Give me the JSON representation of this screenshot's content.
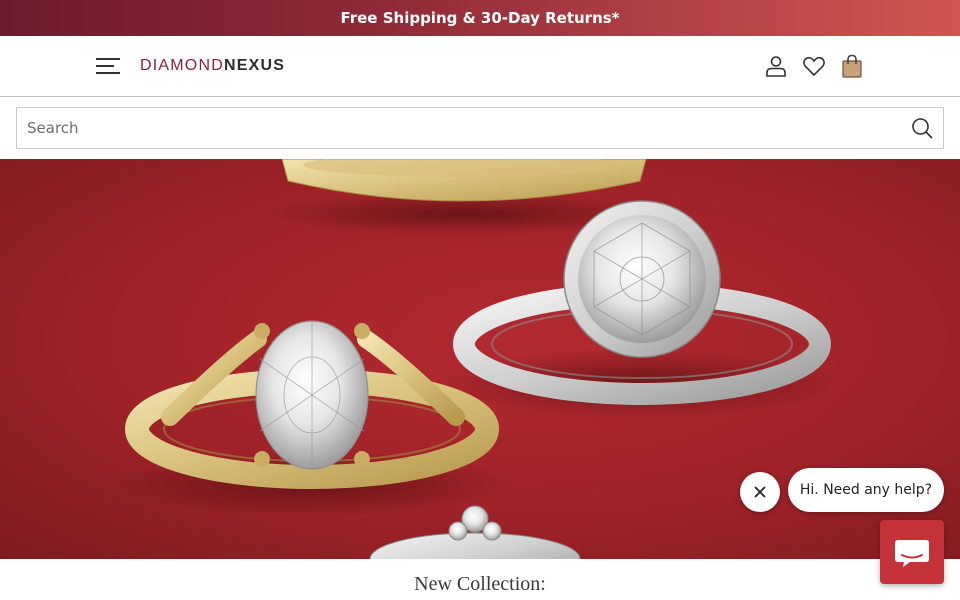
{
  "promo": {
    "text": "Free Shipping & 30-Day Returns*"
  },
  "header": {
    "logo_part1": "DIAMOND",
    "logo_part2": "NEXUS",
    "icons": [
      "menu-icon",
      "user-icon",
      "heart-icon",
      "shopping-bag-icon"
    ]
  },
  "search": {
    "placeholder": "Search"
  },
  "hero": {
    "image": "gold-and-platinum-diamond-rings-on-red"
  },
  "caption": {
    "text": "New Collection:"
  },
  "chat": {
    "bubble_text": "Hi. Need any help?"
  },
  "colors": {
    "brand": "#8b2040",
    "promo_start": "#6e1a2c",
    "promo_end": "#d0574f",
    "hero_bg": "#9e2228",
    "chat_button": "#c6323a"
  }
}
